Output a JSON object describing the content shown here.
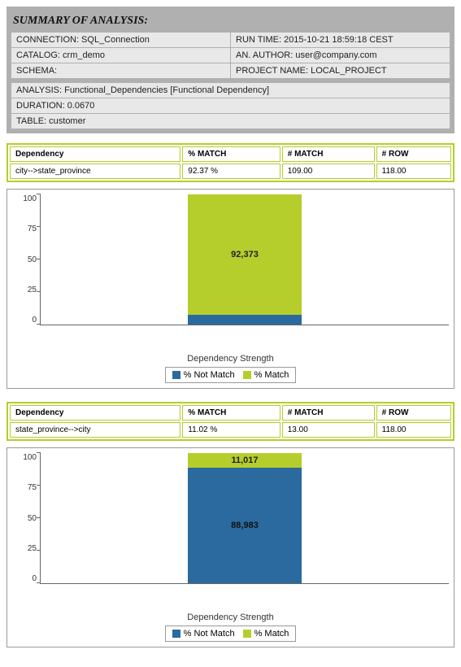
{
  "summary": {
    "title": "SUMMARY OF ANALYSIS:",
    "connection_label": "CONNECTION: SQL_Connection",
    "runtime_label": "RUN TIME: 2015-10-21 18:59:18 CEST",
    "catalog_label": "CATALOG: crm_demo",
    "author_label": "AN. AUTHOR: user@company.com",
    "schema_label": "SCHEMA:",
    "project_label": "PROJECT NAME: LOCAL_PROJECT",
    "analysis_label": "ANALYSIS: Functional_Dependencies [Functional Dependency]",
    "duration_label": "DURATION: 0.0670",
    "table_label": "TABLE: customer"
  },
  "headers": {
    "dependency": "Dependency",
    "pct_match": "% MATCH",
    "n_match": "# MATCH",
    "n_row": "# ROW"
  },
  "analyses": [
    {
      "dependency": "city-->state_province",
      "pct_match": "92.37 %",
      "n_match": "109.00",
      "n_row": "118.00"
    },
    {
      "dependency": "state_province-->city",
      "pct_match": "11.02 %",
      "n_match": "13.00",
      "n_row": "118.00"
    }
  ],
  "chart_data": [
    {
      "type": "bar",
      "title": "",
      "xlabel": "Dependency Strength",
      "ylabel": "",
      "ylim": [
        0,
        100
      ],
      "y_ticks": [
        "0",
        "25",
        "50",
        "75",
        "100"
      ],
      "categories": [
        "Dependency Strength"
      ],
      "series": [
        {
          "name": "% Not Match",
          "values": [
            7.627
          ],
          "label": ""
        },
        {
          "name": "% Match",
          "values": [
            92.373
          ],
          "label": "92,373"
        }
      ],
      "legend": [
        "% Not Match",
        "% Match"
      ]
    },
    {
      "type": "bar",
      "title": "",
      "xlabel": "Dependency Strength",
      "ylabel": "",
      "ylim": [
        0,
        100
      ],
      "y_ticks": [
        "0",
        "25",
        "50",
        "75",
        "100"
      ],
      "categories": [
        "Dependency Strength"
      ],
      "series": [
        {
          "name": "% Not Match",
          "values": [
            88.983
          ],
          "label": "88,983"
        },
        {
          "name": "% Match",
          "values": [
            11.017
          ],
          "label": "11,017"
        }
      ],
      "legend": [
        "% Not Match",
        "% Match"
      ]
    }
  ]
}
